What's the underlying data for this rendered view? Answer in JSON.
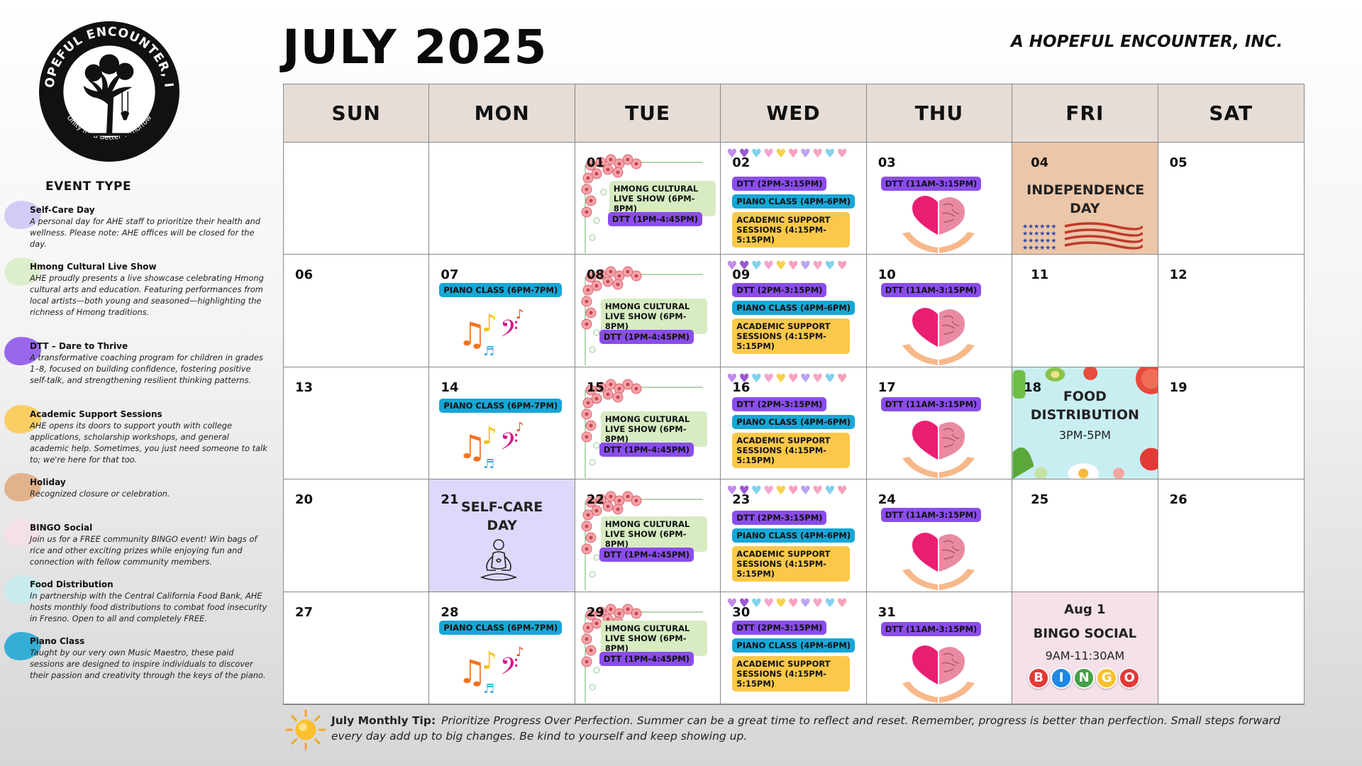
{
  "header": {
    "month_title": "JULY 2025",
    "org_name": "A HOPEFUL ENCOUNTER, INC.",
    "logo_text": "A HOPEFUL ENCOUNTER, INC.",
    "logo_tagline": "Unity for a Better Tomorrow"
  },
  "legend": {
    "title": "EVENT TYPE",
    "items": [
      {
        "name": "Self-Care Day",
        "color": "#c9c4f6",
        "desc": "A personal day for AHE staff to prioritize their health and wellness. Please note: AHE offices will be closed for the day."
      },
      {
        "name": "Hmong Cultural Live Show",
        "color": "#d8ecc4",
        "desc": "AHE proudly presents a live showcase celebrating Hmong cultural arts and education. Featuring performances from local artists—both young and seasoned—highlighting the richness of Hmong traditions."
      },
      {
        "name": "DTT – Dare to Thrive",
        "color": "#8a4dea",
        "desc": "A transformative coaching program for children in grades 1–8, focused on building confidence, fostering positive self-talk, and strengthening resilient thinking patterns."
      },
      {
        "name": "Academic Support Sessions",
        "color": "#fbc84a",
        "desc": "AHE opens its doors to support youth with college applications, scholarship workshops, and general academic help. Sometimes, you just need someone to talk to; we're here for that too."
      },
      {
        "name": "Holiday",
        "color": "#e0a97a",
        "desc": "Recognized closure or celebration."
      },
      {
        "name": "BINGO Social",
        "color": "#f6dfe7",
        "desc": "Join us for a FREE community BINGO event! Win bags of rice and other exciting prizes while enjoying fun and connection with fellow community members."
      },
      {
        "name": "Food Distribution",
        "color": "#c6ecef",
        "desc": "In partnership with the Central California Food Bank, AHE hosts monthly food distributions to combat food insecurity in Fresno. Open to all and completely FREE."
      },
      {
        "name": "Piano Class",
        "color": "#17a6d6",
        "desc": "Taught by our very own Music Maestro, these paid sessions are designed to inspire individuals to discover their passion and creativity through the keys of the piano."
      }
    ]
  },
  "calendar": {
    "days": [
      "SUN",
      "MON",
      "TUE",
      "WED",
      "THU",
      "FRI",
      "SAT"
    ],
    "events": {
      "hmong": "HMONG CULTURAL LIVE SHOW (6PM-8PM)",
      "dtt_tue": "DTT (1PM-4:45PM)",
      "dtt_wed": "DTT  (2PM-3:15PM)",
      "dtt_thu": "DTT  (11AM-3:15PM)",
      "piano_wed": "PIANO CLASS (4PM-6PM)",
      "piano_mon": "PIANO CLASS (6PM-7PM)",
      "academic": "ACADEMIC SUPPORT SESSIONS  (4:15PM-5:15PM)",
      "independence": "INDEPENDENCE DAY",
      "food_title": "FOOD DISTRIBUTION",
      "food_time": "3PM-5PM",
      "selfcare": "SELF-CARE DAY",
      "aug_date": "Aug 1",
      "bingo_title": "BINGO SOCIAL",
      "bingo_time": "9AM-11:30AM",
      "bingo_word": "BINGO"
    },
    "dates": {
      "d01": "01",
      "d02": "02",
      "d03": "03",
      "d04": "04",
      "d05": "05",
      "d06": "06",
      "d07": "07",
      "d08": "08",
      "d09": "09",
      "d10": "10",
      "d11": "11",
      "d12": "12",
      "d13": "13",
      "d14": "14",
      "d15": "15",
      "d16": "16",
      "d17": "17",
      "d18": "18",
      "d19": "19",
      "d20": "20",
      "d21": "21",
      "d22": "22",
      "d23": "23",
      "d24": "24",
      "d25": "25",
      "d26": "26",
      "d27": "27",
      "d28": "28",
      "d29": "29",
      "d30": "30",
      "d31": "31"
    }
  },
  "tip": {
    "label": "July Monthly Tip:",
    "text": "Prioritize Progress Over Perfection. Summer can be a great time to reflect and reset. Remember, progress is better than perfection. Small steps forward every day add up to big changes. Be kind to yourself and keep showing up."
  },
  "colors": {
    "dtt": "#8a4dea",
    "piano": "#17a6d6",
    "academic": "#fbc84a",
    "hmong": "#d7ecc3",
    "holiday": "#ecc6a8",
    "selfcare": "#dcd9fb",
    "bingo": "#f4e1ea",
    "food": "#c9eef2",
    "header": "#e6ddd7"
  }
}
